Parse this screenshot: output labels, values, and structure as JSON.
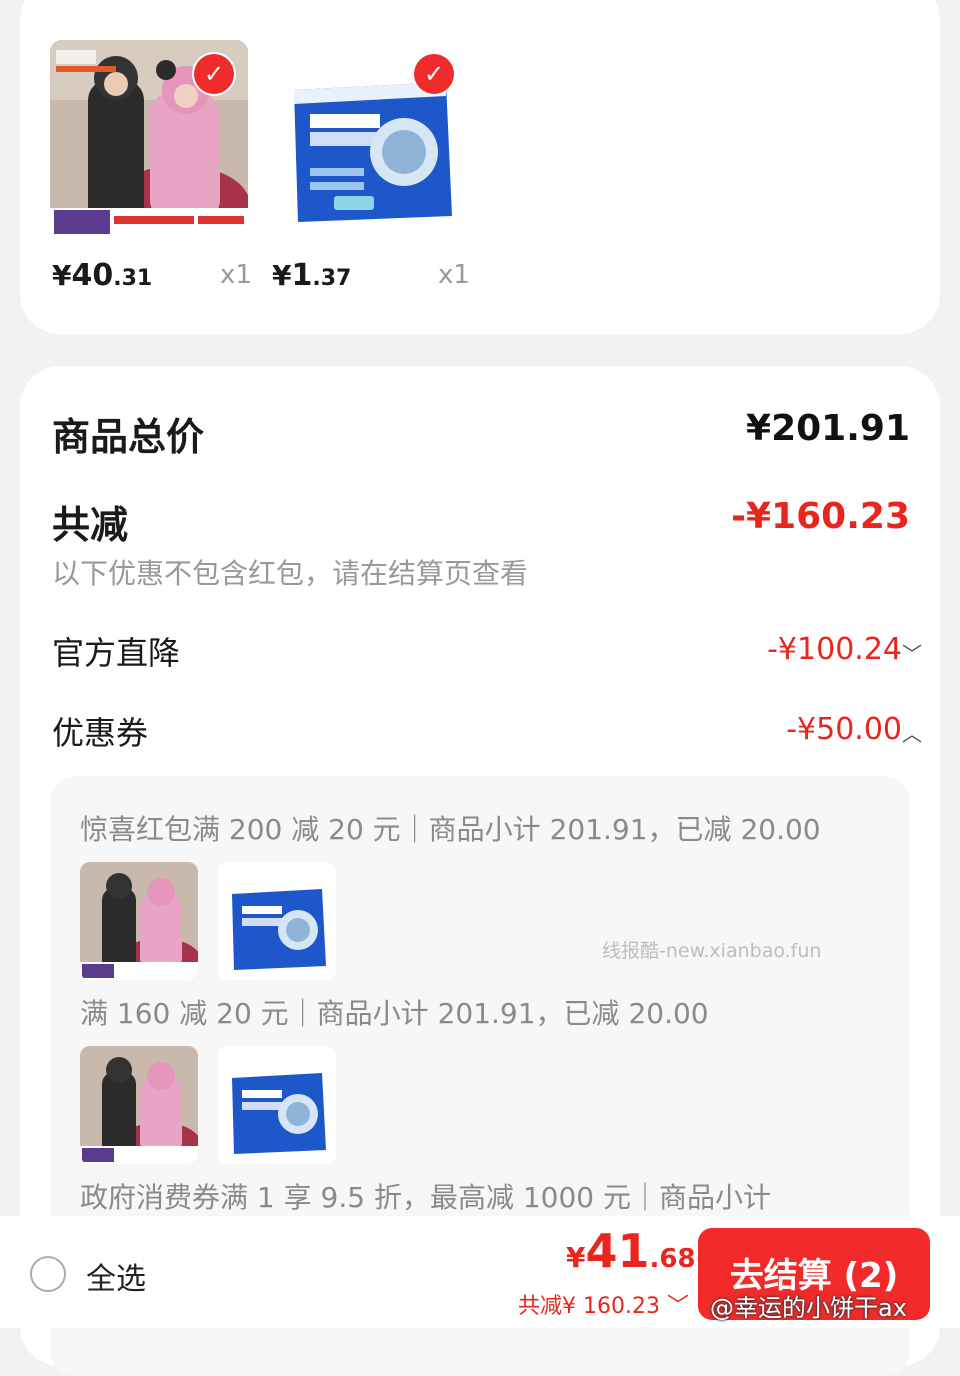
{
  "products": [
    {
      "price_yen": "¥",
      "price_int": "40",
      "price_dec": ".31",
      "qty": "x1",
      "image": "pajama-product"
    },
    {
      "price_yen": "¥",
      "price_int": "1",
      "price_dec": ".37",
      "qty": "x1",
      "image": "washer-cleaner-product"
    }
  ],
  "summary": {
    "total_label": "商品总价",
    "total_value": "¥201.91",
    "discount_label": "共减",
    "discount_value": "-¥160.23",
    "note": "以下优惠不包含红包，请在结算页查看",
    "official_label": "官方直降",
    "official_value": "-¥100.24",
    "coupon_label": "优惠券",
    "coupon_value": "-¥50.00"
  },
  "coupons": {
    "line1": "惊喜红包满 200 减 20 元｜商品小计 201.91，已减 20.00",
    "line2": "满 160 减 20 元｜商品小计 201.91，已减 20.00",
    "line3": "政府消费券满 1 享 9.5 折，最高减 1000 元｜商品小计",
    "watermark": "线报酷-new.xianbao.fun"
  },
  "bottom": {
    "select_all": "全选",
    "pay_yen": "¥",
    "pay_int": "41",
    "pay_dec": ".68",
    "pay_discount": "共减¥ 160.23",
    "checkout": "去结算 (2)",
    "weibo_mark": "@幸运的小饼干ax"
  },
  "colors": {
    "accent_red": "#e8261e",
    "button_red": "#f32a2a",
    "background": "#f2f2f2"
  }
}
